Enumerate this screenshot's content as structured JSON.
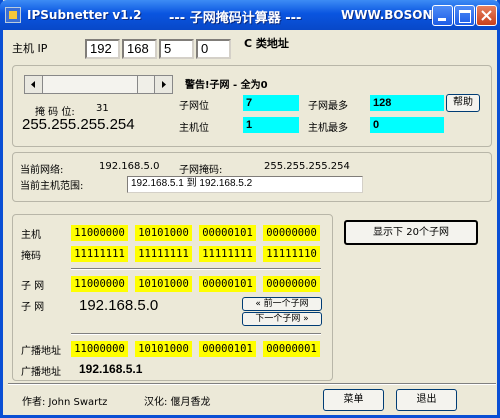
{
  "window": {
    "title": "IPSubnetter v1.2",
    "subtitle": "--- 子网掩码计算器 ---",
    "site": "WWW.BOSON...."
  },
  "ip": {
    "label": "主机 IP",
    "octets": [
      "192",
      "168",
      "5",
      "0"
    ],
    "class_label": "C 类地址"
  },
  "mask_group": {
    "warning": "警告!子网 - 全为0",
    "mask_bits_label": "掩 码 位:",
    "mask_bits_value": "31",
    "mask": "255.255.255.254",
    "subnet_bits_label": "子网位",
    "subnet_bits_value": "7",
    "max_subnets_label": "子网最多",
    "max_subnets_value": "128",
    "host_bits_label": "主机位",
    "host_bits_value": "1",
    "max_hosts_label": "主机最多",
    "max_hosts_value": "0",
    "help_button": "帮助"
  },
  "current": {
    "network_label": "当前网络:",
    "network_value": "192.168.5.0",
    "subnet_mask_label": "子网掩码:",
    "subnet_mask_value": "255.255.255.254",
    "range_label": "当前主机范围:",
    "range_value": "192.168.5.1  到  192.168.5.2"
  },
  "binary": {
    "host_label": "主机",
    "host": [
      "11000000",
      "10101000",
      "00000101",
      "00000000"
    ],
    "mask_label": "掩码",
    "mask": [
      "11111111",
      "11111111",
      "11111111",
      "11111110"
    ],
    "subnet_label": "子 网",
    "subnet": [
      "11000000",
      "10101000",
      "00000101",
      "00000000"
    ],
    "subnet_ip_label": "子 网",
    "subnet_ip": "192.168.5.0",
    "prev_button": "« 前一个子网",
    "next_button": "下一个子网 »",
    "broadcast_label": "广播地址",
    "broadcast": [
      "11000000",
      "10101000",
      "00000101",
      "00000001"
    ],
    "broadcast_ip_label": "广播地址",
    "broadcast_ip": "192.168.5.1"
  },
  "show_button": "显示下 20个子网",
  "footer": {
    "author": "作者: John Swartz",
    "translator": "汉化: 偃月香龙",
    "menu_button": "菜单",
    "exit_button": "退出"
  },
  "colors": {
    "title_bar": "#0a55e0",
    "window_bg": "#ece9d8",
    "cyan": "#00ffff",
    "yellow": "#ffff00"
  }
}
